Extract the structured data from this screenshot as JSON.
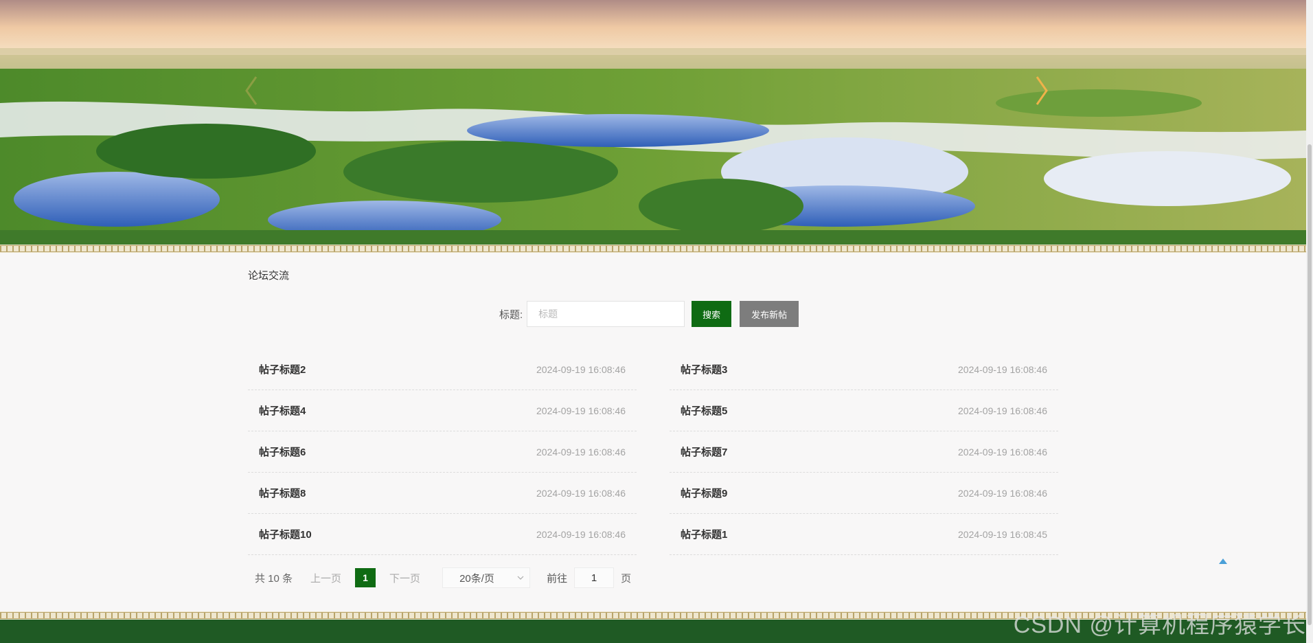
{
  "banner": {
    "prev_icon": "chevron-left-icon",
    "next_icon": "chevron-right-icon"
  },
  "section": {
    "title": "论坛交流"
  },
  "search": {
    "label": "标题:",
    "placeholder": "标题",
    "search_button": "搜索",
    "publish_button": "发布新帖"
  },
  "posts": [
    {
      "title": "帖子标题2",
      "time": "2024-09-19 16:08:46"
    },
    {
      "title": "帖子标题3",
      "time": "2024-09-19 16:08:46"
    },
    {
      "title": "帖子标题4",
      "time": "2024-09-19 16:08:46"
    },
    {
      "title": "帖子标题5",
      "time": "2024-09-19 16:08:46"
    },
    {
      "title": "帖子标题6",
      "time": "2024-09-19 16:08:46"
    },
    {
      "title": "帖子标题7",
      "time": "2024-09-19 16:08:46"
    },
    {
      "title": "帖子标题8",
      "time": "2024-09-19 16:08:46"
    },
    {
      "title": "帖子标题9",
      "time": "2024-09-19 16:08:46"
    },
    {
      "title": "帖子标题10",
      "time": "2024-09-19 16:08:46"
    },
    {
      "title": "帖子标题1",
      "time": "2024-09-19 16:08:45"
    }
  ],
  "pagination": {
    "total": "共 10 条",
    "prev": "上一页",
    "current_page": "1",
    "next": "下一页",
    "page_size": "20条/页",
    "goto_label": "前往",
    "goto_value": "1",
    "page_suffix": "页"
  },
  "watermark": "CSDN @计算机程序猿学长",
  "colors": {
    "primary_green": "#0f6b13",
    "publish_gray": "#7d7d7d",
    "footer_green": "#1f5a24",
    "back_to_top": "#4aa0d8"
  }
}
